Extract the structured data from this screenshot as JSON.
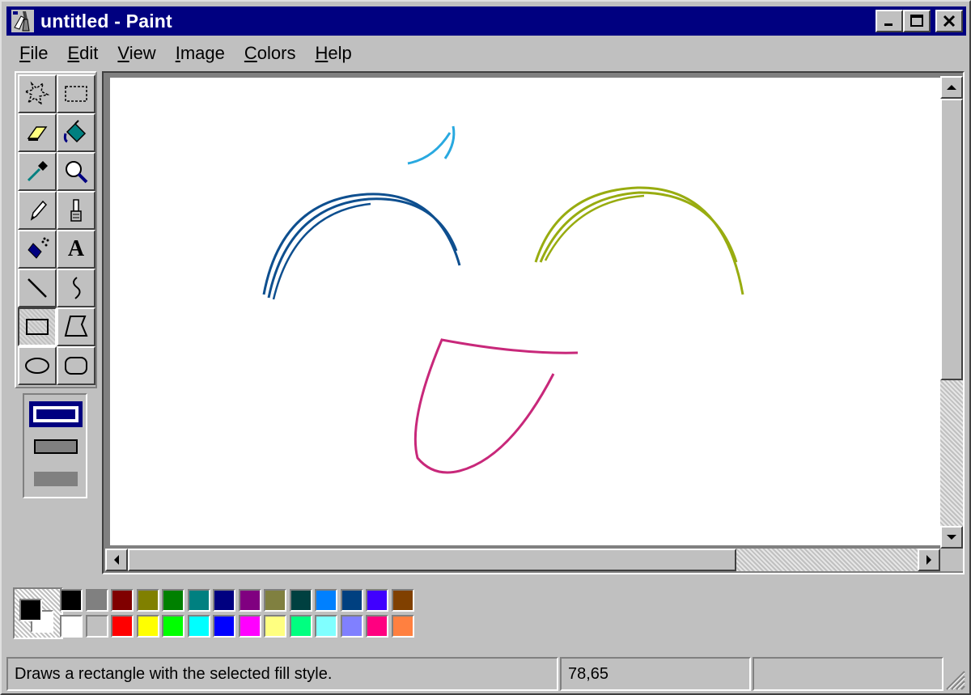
{
  "window": {
    "title": "untitled - Paint",
    "app_icon": "paint-app-icon",
    "controls": [
      "minimize-icon",
      "maximize-icon",
      "close-icon"
    ],
    "title_bg": "#000080"
  },
  "menu": [
    {
      "pre": "",
      "ul": "F",
      "post": "ile"
    },
    {
      "pre": "",
      "ul": "E",
      "post": "dit"
    },
    {
      "pre": "",
      "ul": "V",
      "post": "iew"
    },
    {
      "pre": "",
      "ul": "I",
      "post": "mage"
    },
    {
      "pre": "",
      "ul": "C",
      "post": "olors"
    },
    {
      "pre": "",
      "ul": "H",
      "post": "elp"
    }
  ],
  "tools": [
    {
      "name": "free-form-select-icon"
    },
    {
      "name": "select-icon"
    },
    {
      "name": "eraser-icon"
    },
    {
      "name": "fill-bucket-icon"
    },
    {
      "name": "pick-color-icon"
    },
    {
      "name": "magnifier-icon"
    },
    {
      "name": "pencil-icon"
    },
    {
      "name": "brush-icon"
    },
    {
      "name": "airbrush-icon"
    },
    {
      "name": "text-icon",
      "glyph": "A"
    },
    {
      "name": "line-icon"
    },
    {
      "name": "curve-icon"
    },
    {
      "name": "rectangle-icon",
      "selected": true
    },
    {
      "name": "polygon-icon"
    },
    {
      "name": "ellipse-icon"
    },
    {
      "name": "rounded-rectangle-icon"
    }
  ],
  "fill_styles": [
    "outline-only",
    "outline-and-fill",
    "fill-only"
  ],
  "selected_fill_style": "outline-only",
  "canvas_strokes": [
    {
      "name": "cyan-stroke",
      "color": "#29a9e0"
    },
    {
      "name": "blue-arc-stroke",
      "color": "#0e4f8f"
    },
    {
      "name": "olive-arc-stroke",
      "color": "#98ac10"
    },
    {
      "name": "magenta-mouth-stroke",
      "color": "#c8287a"
    }
  ],
  "palette": {
    "foreground": "#000000",
    "background": "#ffffff",
    "top_row": [
      "#000000",
      "#808080",
      "#800000",
      "#808000",
      "#008000",
      "#008080",
      "#000080",
      "#800080",
      "#808040",
      "#004040",
      "#0080ff",
      "#004080",
      "#4000ff",
      "#804000"
    ],
    "bottom_row": [
      "#ffffff",
      "#c0c0c0",
      "#ff0000",
      "#ffff00",
      "#00ff00",
      "#00ffff",
      "#0000ff",
      "#ff00ff",
      "#ffff80",
      "#00ff80",
      "#80ffff",
      "#8080ff",
      "#ff0080",
      "#ff8040"
    ]
  },
  "status": {
    "message": "Draws a rectangle with the selected fill style.",
    "coords": "78,65",
    "size": ""
  }
}
